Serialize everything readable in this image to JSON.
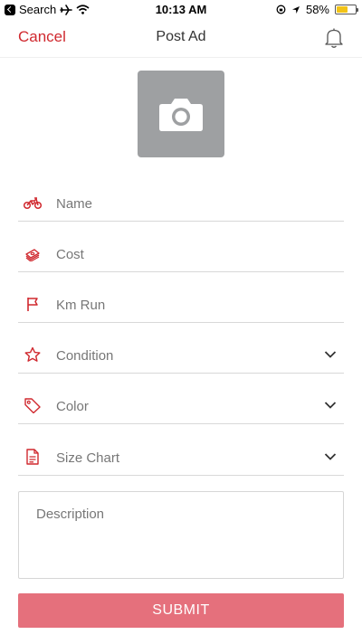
{
  "status_bar": {
    "back_label": "Search",
    "time": "10:13 AM",
    "battery_percent": "58%",
    "battery_level": 0.58
  },
  "nav": {
    "cancel_label": "Cancel",
    "title": "Post Ad"
  },
  "form": {
    "name_placeholder": "Name",
    "cost_placeholder": "Cost",
    "km_run_placeholder": "Km Run",
    "condition_placeholder": "Condition",
    "color_placeholder": "Color",
    "size_chart_placeholder": "Size Chart",
    "description_placeholder": "Description",
    "submit_label": "SUBMIT"
  },
  "icons": {
    "name": "motorcycle-icon",
    "cost": "money-icon",
    "km_run": "flag-icon",
    "condition": "star-icon",
    "color": "tag-icon",
    "size_chart": "document-icon"
  },
  "colors": {
    "accent": "#d0292f",
    "submit_bg": "#e5707c",
    "photo_bg": "#9ea0a2"
  }
}
